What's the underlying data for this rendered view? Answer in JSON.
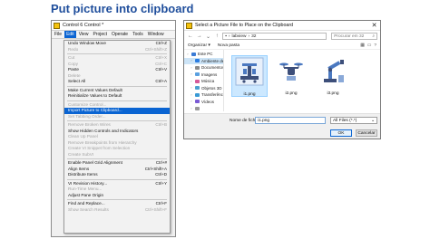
{
  "slide_title": "Put picture into clipboard",
  "labview": {
    "window_title": "Control 6 Control *",
    "menus": [
      "File",
      "Edit",
      "View",
      "Project",
      "Operate",
      "Tools",
      "Window"
    ],
    "active_menu_index": 1,
    "edit_menu": [
      {
        "label": "Undo Window Move",
        "shortcut": "Ctrl+Z",
        "disabled": false
      },
      {
        "label": "Redo",
        "shortcut": "Ctrl+Shift+Z",
        "disabled": true
      },
      {
        "sep": true
      },
      {
        "label": "Cut",
        "shortcut": "Ctrl+X",
        "disabled": true
      },
      {
        "label": "Copy",
        "shortcut": "Ctrl+C",
        "disabled": true
      },
      {
        "label": "Paste",
        "shortcut": "Ctrl+V",
        "disabled": false
      },
      {
        "label": "Delete",
        "shortcut": "",
        "disabled": true
      },
      {
        "label": "Select All",
        "shortcut": "Ctrl+A",
        "disabled": false
      },
      {
        "sep": true
      },
      {
        "label": "Make Current Values Default",
        "shortcut": "",
        "disabled": false
      },
      {
        "label": "Reinitialize Values to Default",
        "shortcut": "",
        "disabled": false
      },
      {
        "sep": true
      },
      {
        "label": "Customize Control...",
        "shortcut": "",
        "disabled": true
      },
      {
        "label": "Import Picture to Clipboard...",
        "shortcut": "",
        "disabled": false,
        "highlight": true
      },
      {
        "label": "Set Tabbing Order...",
        "shortcut": "",
        "disabled": true
      },
      {
        "sep": true
      },
      {
        "label": "Remove Broken Wires",
        "shortcut": "Ctrl+B",
        "disabled": true
      },
      {
        "label": "Show Hidden Controls and Indicators",
        "shortcut": "",
        "disabled": false
      },
      {
        "label": "Clean Up Panel",
        "shortcut": "",
        "disabled": true
      },
      {
        "label": "Remove Breakpoints from Hierarchy",
        "shortcut": "",
        "disabled": true
      },
      {
        "label": "Create VI Snippet from Selection",
        "shortcut": "",
        "disabled": true
      },
      {
        "label": "Create SubVI",
        "shortcut": "",
        "disabled": true
      },
      {
        "sep": true
      },
      {
        "label": "Enable Panel Grid Alignment",
        "shortcut": "Ctrl+#",
        "disabled": false
      },
      {
        "label": "Align Items",
        "shortcut": "Ctrl+Shift+A",
        "disabled": false
      },
      {
        "label": "Distribute Items",
        "shortcut": "Ctrl+D",
        "disabled": false
      },
      {
        "sep": true
      },
      {
        "label": "VI Revision History...",
        "shortcut": "Ctrl+Y",
        "disabled": false
      },
      {
        "label": "Run-Time Menu...",
        "shortcut": "",
        "disabled": true
      },
      {
        "label": "Adjust Pane Origin",
        "shortcut": "",
        "disabled": false
      },
      {
        "sep": true
      },
      {
        "label": "Find and Replace...",
        "shortcut": "Ctrl+F",
        "disabled": false
      },
      {
        "label": "Show Search Results",
        "shortcut": "Ctrl+Shift+F",
        "disabled": true
      }
    ]
  },
  "dialog": {
    "title": "Select a Picture File to Place on the Clipboard",
    "close_glyph": "✕",
    "path": [
      "labview",
      "32"
    ],
    "search_placeholder": "Procurar em 32",
    "organize_label": "Organizar ▾",
    "new_folder_label": "Nova pasta",
    "sidebar": [
      {
        "label": "Este PC",
        "icon_color": "#3a7bd5",
        "level": 0
      },
      {
        "label": "Ambiente de tra",
        "icon_color": "#2b7de0",
        "level": 1,
        "selected": true
      },
      {
        "label": "Documentos",
        "icon_color": "#8a8a8a",
        "level": 1
      },
      {
        "label": "Imagens",
        "icon_color": "#5aa0e0",
        "level": 1
      },
      {
        "label": "Música",
        "icon_color": "#d55a9a",
        "level": 1
      },
      {
        "label": "Objetos 3D",
        "icon_color": "#4aa0d0",
        "level": 1
      },
      {
        "label": "Transferências",
        "icon_color": "#3a9ad5",
        "level": 1
      },
      {
        "label": "Vídeos",
        "icon_color": "#7a5ad5",
        "level": 1
      },
      {
        "label": "",
        "icon_color": "#999999",
        "level": 1
      }
    ],
    "files": [
      {
        "name": "i1.png",
        "selected": true,
        "icon": "machine-icon"
      },
      {
        "name": "i2.png",
        "selected": false,
        "icon": "drone-icon"
      },
      {
        "name": "i3.png",
        "selected": false,
        "icon": "robot-arm-icon"
      }
    ],
    "filename_label": "Nome de ficheiro:",
    "filename_value": "i1.png",
    "filetype_value": "All Files (*.*)",
    "ok_label": "OK",
    "cancel_label": "Cancelar"
  },
  "colors": {
    "title": "#1f4e9c",
    "menu_highlight": "#0a64d2",
    "selection": "#cce8ff"
  }
}
